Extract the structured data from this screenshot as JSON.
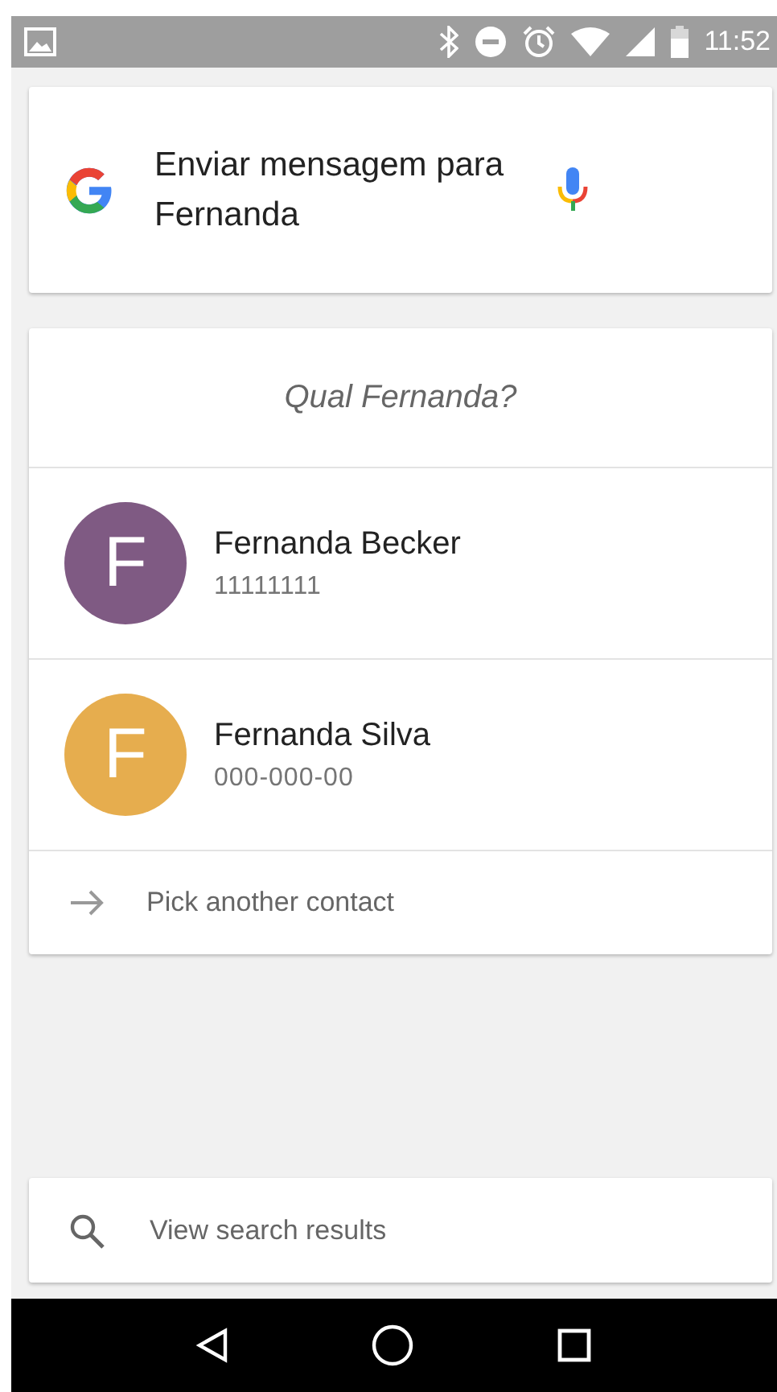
{
  "status_bar": {
    "time": "11:52"
  },
  "query": {
    "text": "Enviar mensagem para Fernanda"
  },
  "disambiguation": {
    "title": "Qual Fernanda?",
    "contacts": [
      {
        "initial": "F",
        "name": "Fernanda Becker",
        "number": "11111111",
        "color": "#7f5a83"
      },
      {
        "initial": "F",
        "name": "Fernanda Silva",
        "number": "000-000-00",
        "color": "#e6ad4e"
      }
    ],
    "more": "Pick another contact"
  },
  "search_results": {
    "label": "View search results"
  }
}
